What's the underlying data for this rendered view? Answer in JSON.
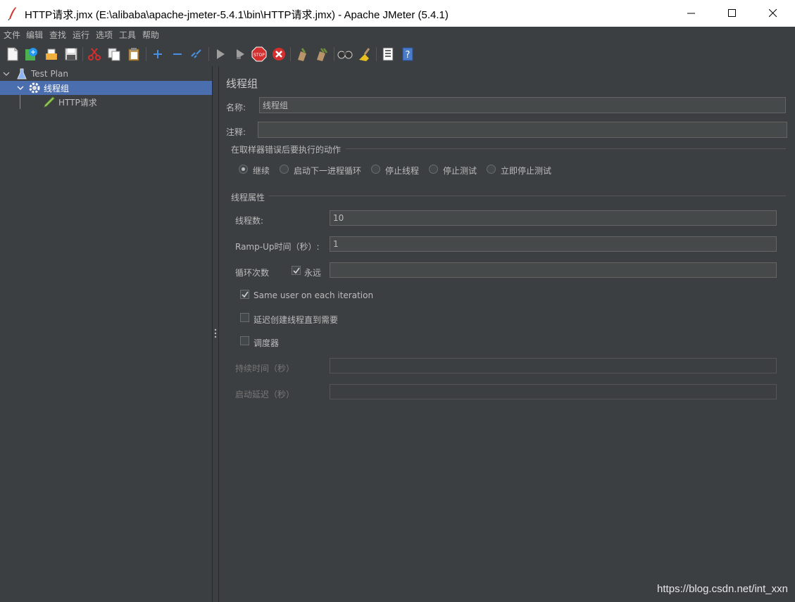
{
  "window": {
    "title": "HTTP请求.jmx (E:\\alibaba\\apache-jmeter-5.4.1\\bin\\HTTP请求.jmx) - Apache JMeter (5.4.1)"
  },
  "menu": [
    "文件",
    "编辑",
    "查找",
    "运行",
    "选项",
    "工具",
    "帮助"
  ],
  "toolbar_icons": [
    "new-icon",
    "templates-icon",
    "open-icon",
    "save-icon",
    "cut-icon",
    "copy-icon",
    "paste-icon",
    "expand-icon",
    "collapse-icon",
    "toggle-icon",
    "start-icon",
    "start-no-pause-icon",
    "stop-icon",
    "shutdown-icon",
    "clear-icon",
    "clear-all-icon",
    "search-icon",
    "reset-search-icon",
    "function-helper-icon",
    "help-icon"
  ],
  "tree": {
    "items": [
      {
        "label": "Test Plan",
        "icon": "test-plan-icon"
      },
      {
        "label": "线程组",
        "icon": "gear-icon"
      },
      {
        "label": "HTTP请求",
        "icon": "sampler-pen-icon"
      }
    ]
  },
  "panel": {
    "title": "线程组",
    "name_label": "名称:",
    "name_value": "线程组",
    "comment_label": "注释:",
    "comment_value": "",
    "error_action_title": "在取样器错误后要执行的动作",
    "error_actions": [
      "继续",
      "启动下一进程循环",
      "停止线程",
      "停止测试",
      "立即停止测试"
    ],
    "error_action_selected": "继续",
    "thread_props_title": "线程属性",
    "threads_label": "线程数:",
    "threads_value": "10",
    "rampup_label": "Ramp-Up时间（秒）:",
    "rampup_value": "1",
    "loop_label": "循环次数",
    "forever_label": "永远",
    "forever_checked": true,
    "loop_value": "",
    "same_user_label": "Same user on each iteration",
    "same_user_checked": true,
    "delay_create_label": "延迟创建线程直到需要",
    "delay_create_checked": false,
    "scheduler_label": "调度器",
    "scheduler_checked": false,
    "duration_label": "持续时间（秒）",
    "duration_value": "",
    "startup_delay_label": "启动延迟（秒）",
    "startup_delay_value": ""
  },
  "watermark": "https://blog.csdn.net/int_xxn",
  "colors": {
    "background": "#3c3f41",
    "selection": "#4b6eaf",
    "text": "#bbbbbb"
  }
}
